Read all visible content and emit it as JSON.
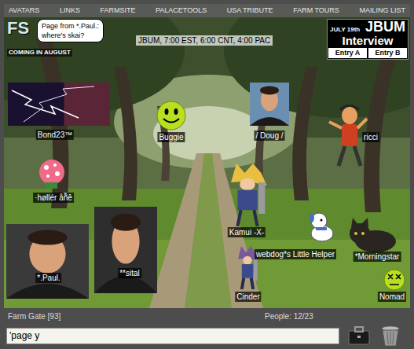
{
  "nav": {
    "links": [
      "AVATARS",
      "LINKS",
      "FARMSITE",
      "PALACETOOLS",
      "USA TRIBUTE",
      "FARM TOURS",
      "MAILING LIST"
    ]
  },
  "room": {
    "logo": {
      "text": "FS",
      "tagline": "COMING IN AUGUST"
    },
    "page_bubble": {
      "lines": [
        "Page from *.Paul.:",
        "where's skai?"
      ]
    },
    "schedule": "JBUM, 7:00 EST, 6:00 CNT, 4:00 PAC",
    "banner": {
      "date": "JULY 19th",
      "title": "JBUM",
      "subtitle": "Interview",
      "entries": [
        "Entry A",
        "Entry B"
      ]
    }
  },
  "avatars": [
    {
      "name": "Bond23™",
      "kind": "lightning",
      "color": "#1a1030"
    },
    {
      "name": "Buggie",
      "kind": "smiley",
      "color": "#b8e020"
    },
    {
      "name": "/ Doug /",
      "kind": "photo",
      "color": "#6b8fb0"
    },
    {
      "name": "ricci",
      "kind": "cartoon",
      "color": "#d04020"
    },
    {
      "name": "·høllér åñ̃ê",
      "kind": "ball",
      "color": "#f06a8a"
    },
    {
      "name": "Kamui -X-",
      "kind": "anime",
      "color": "#e8c040"
    },
    {
      "name": "webdog*s Little Helper",
      "kind": "dog",
      "color": "#ffffff"
    },
    {
      "name": "*Morningstar",
      "kind": "cat",
      "color": "#2a2520"
    },
    {
      "name": "*.Paul.",
      "kind": "photo",
      "color": "#3a3a3a"
    },
    {
      "name": "**sital",
      "kind": "photo",
      "color": "#2e2e2e"
    },
    {
      "name": "Cinder",
      "kind": "anime",
      "color": "#7a5a9a"
    },
    {
      "name": "Nomad",
      "kind": "dazed",
      "color": "#b8e020"
    }
  ],
  "status": {
    "room": "Farm Gate [93]",
    "people": "People: 12/23"
  },
  "input": {
    "value": "'page y"
  }
}
